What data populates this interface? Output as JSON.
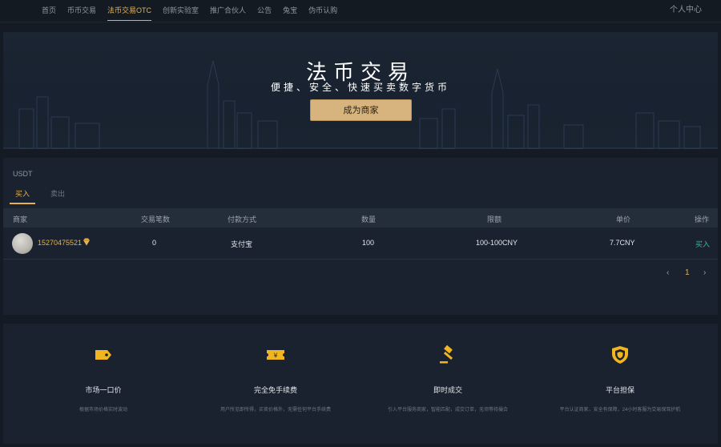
{
  "nav": {
    "items": [
      {
        "label": "首页",
        "active": false
      },
      {
        "label": "币币交易",
        "active": false
      },
      {
        "label": "法币交易OTC",
        "active": true
      },
      {
        "label": "创新实验室",
        "active": false
      },
      {
        "label": "推广合伙人",
        "active": false
      },
      {
        "label": "公告",
        "active": false
      },
      {
        "label": "兔宝",
        "active": false
      },
      {
        "label": "伪币认购",
        "active": false
      }
    ],
    "user_center": "个人中心"
  },
  "banner": {
    "title": "法币交易",
    "subtitle": "便捷、安全、快速买卖数字货币",
    "merchant_button": "成为商家"
  },
  "trade": {
    "coin": "USDT",
    "tabs": [
      {
        "label": "买入",
        "active": true
      },
      {
        "label": "卖出",
        "active": false
      }
    ],
    "columns": [
      "商家",
      "交易笔数",
      "付款方式",
      "数量",
      "限额",
      "单价",
      "操作"
    ],
    "rows": [
      {
        "merchant": "15270475521",
        "trades": "0",
        "payment": "支付宝",
        "amount": "100",
        "limit": "100-100CNY",
        "price": "7.7CNY",
        "action": "买入"
      }
    ],
    "pager": {
      "prev": "‹",
      "page": "1",
      "next": "›"
    }
  },
  "features": [
    {
      "icon": "price-tag-icon",
      "title": "市场一口价",
      "desc": "根据市场价格实时波动"
    },
    {
      "icon": "ticket-icon",
      "title": "完全免手续费",
      "desc": "用户所见即所得，买卖价格外，无需任何平台手续费"
    },
    {
      "icon": "gavel-icon",
      "title": "即时成交",
      "desc": "引入平台服务商家，智能匹配，成交订单，无须等待撮合"
    },
    {
      "icon": "shield-icon",
      "title": "平台担保",
      "desc": "平台认证商家，安全有保障，24小时客服为交易保驾护航"
    }
  ],
  "colors": {
    "accent": "#e7b14e",
    "buy": "#27c28a",
    "button": "#d7b37d"
  }
}
